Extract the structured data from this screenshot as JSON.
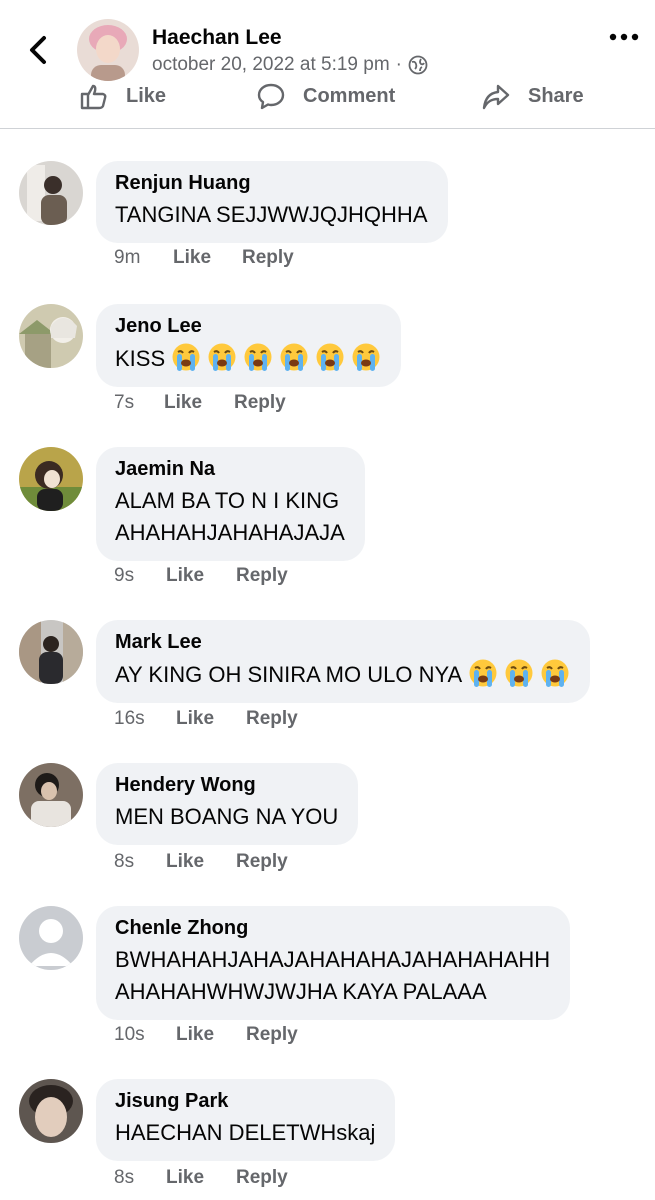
{
  "post": {
    "author": "Haechan Lee",
    "timestamp": "october 20, 2022 at 5:19 pm",
    "separator": "·",
    "privacy_icon": "globe-icon",
    "actions": {
      "like": "Like",
      "comment": "Comment",
      "share": "Share"
    }
  },
  "comments": [
    {
      "name": "Renjun Huang",
      "lines": [
        "TANGINA SEJJWWJQJHQHHA"
      ],
      "emoji_count": 0,
      "time": "9m",
      "like": "Like",
      "reply": "Reply"
    },
    {
      "name": "Jeno Lee",
      "lines": [
        "KISS"
      ],
      "emoji_count": 6,
      "time": "7s",
      "like": "Like",
      "reply": "Reply"
    },
    {
      "name": "Jaemin Na",
      "lines": [
        "ALAM BA TO N I KING",
        "AHAHAHJAHAHAJAJA"
      ],
      "emoji_count": 0,
      "time": "9s",
      "like": "Like",
      "reply": "Reply"
    },
    {
      "name": "Mark Lee",
      "lines": [
        "AY KING OH SINIRA MO ULO NYA"
      ],
      "emoji_count": 3,
      "time": "16s",
      "like": "Like",
      "reply": "Reply"
    },
    {
      "name": "Hendery Wong",
      "lines": [
        "MEN BOANG NA YOU"
      ],
      "emoji_count": 0,
      "time": "8s",
      "like": "Like",
      "reply": "Reply"
    },
    {
      "name": "Chenle Zhong",
      "lines": [
        "BWHAHAHJAHAJAHAHAHAJAHAHAHAHH",
        "AHAHAHWHWJWJHA KAYA PALAAA"
      ],
      "emoji_count": 0,
      "time": "10s",
      "like": "Like",
      "reply": "Reply"
    },
    {
      "name": "Jisung Park",
      "lines": [
        "HAECHAN DELETWHskaj"
      ],
      "emoji_count": 0,
      "time": "8s",
      "like": "Like",
      "reply": "Reply"
    }
  ],
  "icons": {
    "emoji": "loudly-crying-face-icon",
    "back": "chevron-left-icon",
    "more": "more-dots-icon"
  },
  "colors": {
    "bubble": "#f0f2f5",
    "secondary_text": "#65676b",
    "primary_text": "#050505"
  }
}
